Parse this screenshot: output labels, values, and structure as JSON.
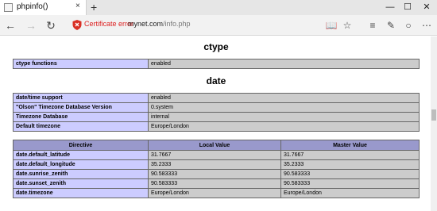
{
  "browser": {
    "tab_title": "phpinfo()",
    "tab_close": "×",
    "new_tab": "+",
    "cert_error": "Certificate error",
    "url_host": "mynet.com",
    "url_path": "/info.php"
  },
  "sections": {
    "ctype": {
      "title": "ctype",
      "rows": [
        {
          "label": "ctype functions",
          "value": "enabled"
        }
      ]
    },
    "date": {
      "title": "date",
      "rows": [
        {
          "label": "date/time support",
          "value": "enabled"
        },
        {
          "label": "\"Olson\" Timezone Database Version",
          "value": "0.system"
        },
        {
          "label": "Timezone Database",
          "value": "internal"
        },
        {
          "label": "Default timezone",
          "value": "Europe/London"
        }
      ],
      "directives": {
        "headers": [
          "Directive",
          "Local Value",
          "Master Value"
        ],
        "rows": [
          {
            "name": "date.default_latitude",
            "local": "31.7667",
            "master": "31.7667"
          },
          {
            "name": "date.default_longitude",
            "local": "35.2333",
            "master": "35.2333"
          },
          {
            "name": "date.sunrise_zenith",
            "local": "90.583333",
            "master": "90.583333"
          },
          {
            "name": "date.sunset_zenith",
            "local": "90.583333",
            "master": "90.583333"
          },
          {
            "name": "date.timezone",
            "local": "Europe/London",
            "master": "Europe/London"
          }
        ]
      }
    }
  }
}
